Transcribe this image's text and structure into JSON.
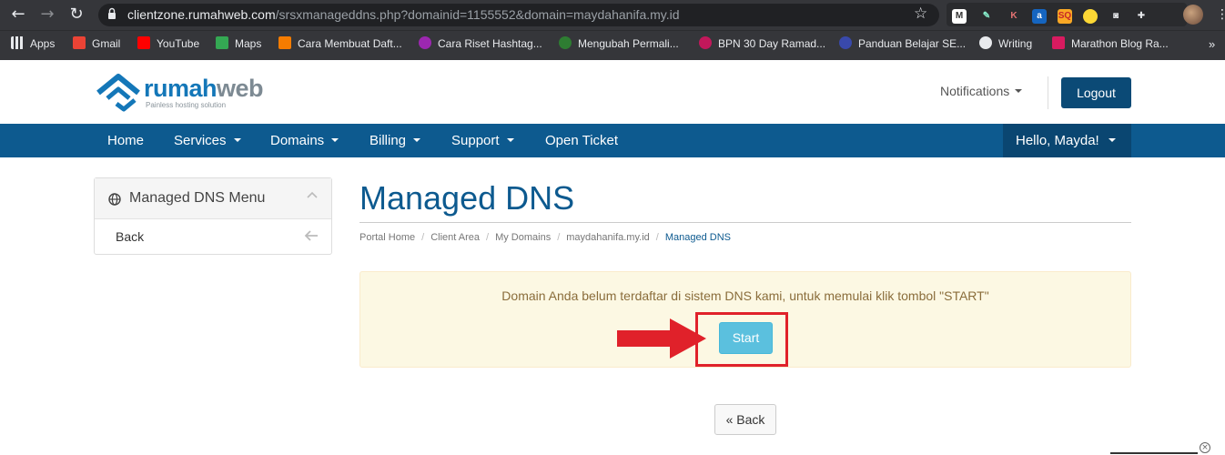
{
  "browser": {
    "url_host": "clientzone.rumahweb.com",
    "url_path": "/srsxmanageddns.php?domainid=1155552&domain=maydahanifa.my.id",
    "bookmarks": [
      {
        "label": "Apps",
        "color": "#e8eaed"
      },
      {
        "label": "Gmail",
        "color": "#ea4335"
      },
      {
        "label": "YouTube",
        "color": "#ff0000"
      },
      {
        "label": "Maps",
        "color": "#34a853"
      },
      {
        "label": "Cara Membuat Daft...",
        "color": "#f57c00"
      },
      {
        "label": "Cara Riset Hashtag...",
        "color": "#9c27b0"
      },
      {
        "label": "Mengubah Permali...",
        "color": "#2e7d32"
      },
      {
        "label": "BPN 30 Day Ramad...",
        "color": "#c2185b"
      },
      {
        "label": "Panduan Belajar SE...",
        "color": "#3949ab"
      },
      {
        "label": "Writing",
        "color": "#e8eaed"
      },
      {
        "label": "Marathon Blog Ra...",
        "color": "#d81b60"
      }
    ],
    "bookmarks_more": "»"
  },
  "header": {
    "logo_main": "rumah",
    "logo_accent": "web",
    "logo_tagline": "Painless hosting solution",
    "notifications_label": "Notifications",
    "logout_label": "Logout"
  },
  "nav": {
    "items": [
      {
        "label": "Home",
        "dropdown": false
      },
      {
        "label": "Services",
        "dropdown": true
      },
      {
        "label": "Domains",
        "dropdown": true
      },
      {
        "label": "Billing",
        "dropdown": true
      },
      {
        "label": "Support",
        "dropdown": true
      },
      {
        "label": "Open Ticket",
        "dropdown": false
      }
    ],
    "greeting": "Hello, Mayda!"
  },
  "sidebar": {
    "title": "Managed DNS Menu",
    "back_label": "Back"
  },
  "main": {
    "title": "Managed DNS",
    "breadcrumb": [
      "Portal Home",
      "Client Area",
      "My Domains",
      "maydahanifa.my.id",
      "Managed DNS"
    ],
    "alert_message": "Domain Anda belum terdaftar di sistem DNS kami, untuk memulai klik tombol \"START\"",
    "start_label": "Start",
    "back_label": "« Back"
  },
  "colors": {
    "brand": "#0d5a8f",
    "alert_bg": "#fcf8e3",
    "start_button": "#5bc0de",
    "annotation_red": "#e0212a"
  }
}
